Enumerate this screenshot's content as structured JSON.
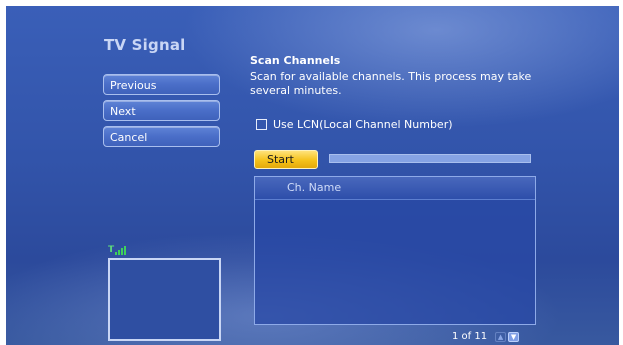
{
  "title": "TV Signal",
  "nav": {
    "previous": "Previous",
    "next": "Next",
    "cancel": "Cancel"
  },
  "scan": {
    "title": "Scan Channels",
    "description": "Scan for available channels. This process may take several minutes.",
    "lcn_label": "Use LCN(Local Channel Number)",
    "lcn_checked": false,
    "start_label": "Start",
    "progress": 0
  },
  "channel_list": {
    "column_header": "Ch. Name",
    "rows": []
  },
  "pager": {
    "text": "1 of 11"
  },
  "icons": {
    "signal": "signal-strength-icon",
    "up": "chevron-up-icon",
    "down": "chevron-down-icon"
  },
  "colors": {
    "accent_start": "#f5c21b",
    "signal_green": "#3fd15a"
  }
}
